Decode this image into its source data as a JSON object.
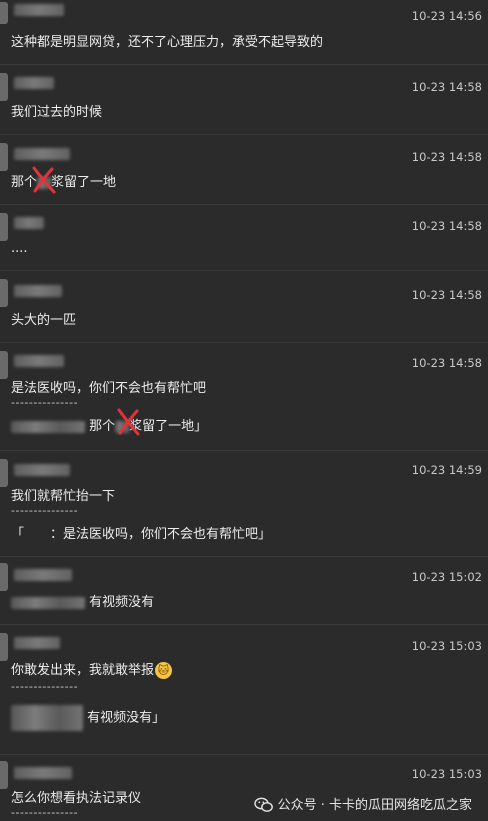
{
  "messages": [
    {
      "time": "10-23 14:56",
      "text": "这种都是明显网贷，还不了心理压力，承受不起导致的"
    },
    {
      "time": "10-23 14:58",
      "text": "我们过去的时候"
    },
    {
      "time": "10-23 14:58",
      "text_before": "那个",
      "text_after": "浆留了一地"
    },
    {
      "time": "10-23 14:58",
      "text": "...."
    },
    {
      "time": "10-23 14:58",
      "text": "头大的一匹"
    },
    {
      "time": "10-23 14:58",
      "text": "是法医收吗，你们不会也有帮忙吧",
      "separator": "---------------",
      "quote_before": "那个",
      "quote_after": "浆留了一地」"
    },
    {
      "time": "10-23 14:59",
      "text": "我们就帮忙抬一下",
      "separator": "---------------",
      "quote": "「　　：是法医收吗，你们不会也有帮忙吧」"
    },
    {
      "time": "10-23 15:02",
      "text": "有视频没有"
    },
    {
      "time": "10-23 15:03",
      "text": "你敢发出来，我就敢举报",
      "separator": "---------------",
      "quote": "有视频没有」"
    },
    {
      "time": "10-23 15:03",
      "text": "怎么你想看执法记录仪",
      "separator": "---------------"
    }
  ],
  "watermark": {
    "text": "公众号 · 卡卡的瓜田网络吃瓜之家",
    "icon": "wechat-icon"
  }
}
